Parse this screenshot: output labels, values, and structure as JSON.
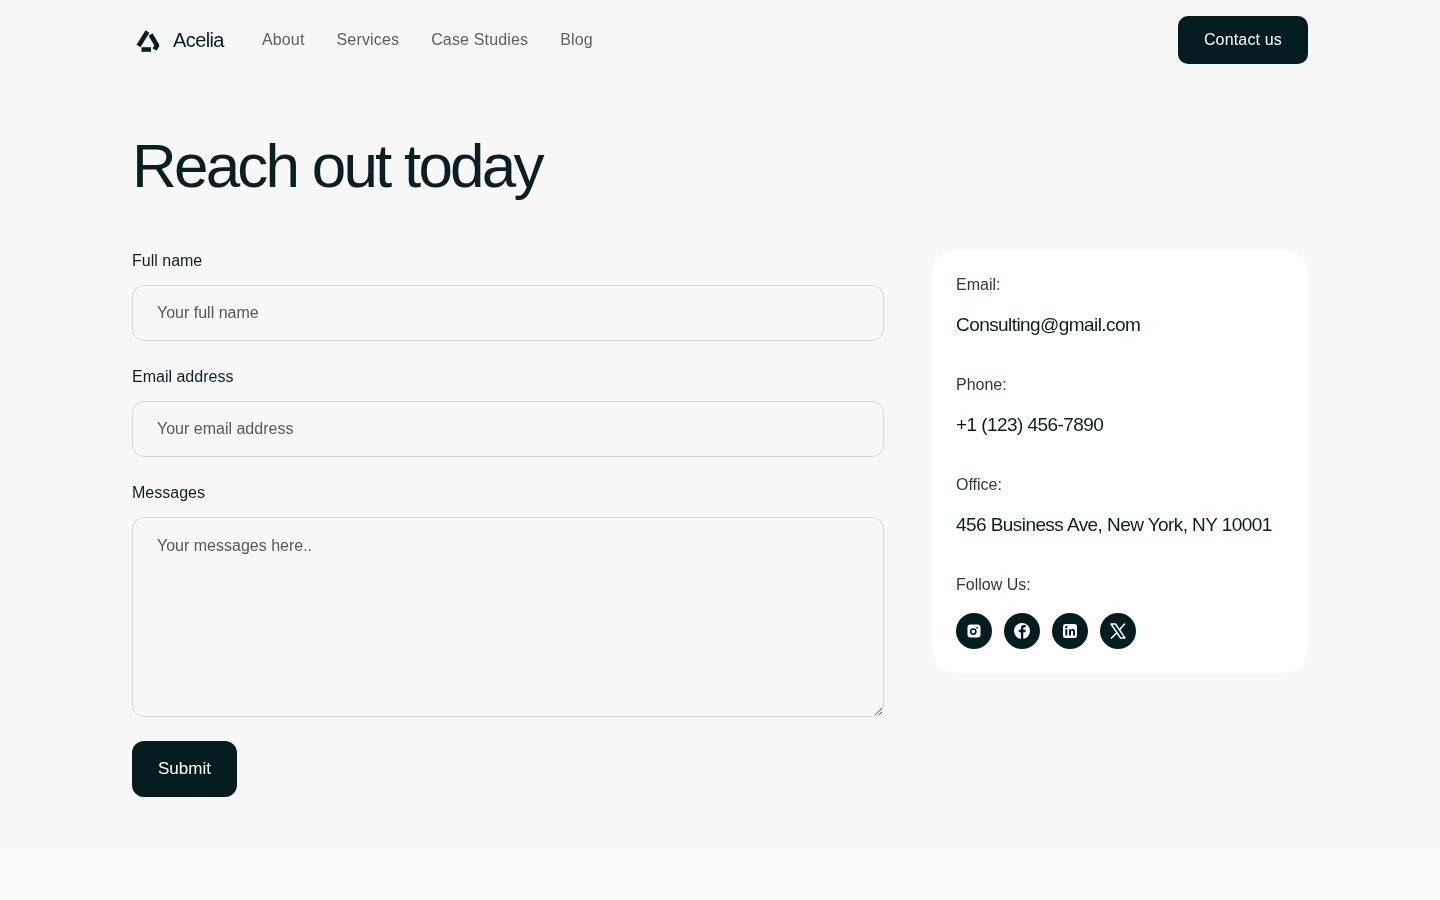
{
  "nav": {
    "brand": "Acelia",
    "links": [
      "About",
      "Services",
      "Case Studies",
      "Blog"
    ],
    "cta": "Contact us"
  },
  "heading": "Reach out today",
  "form": {
    "fields": [
      {
        "kind": "input",
        "label": "Full name",
        "placeholder": "Your full name"
      },
      {
        "kind": "input",
        "label": "Email address",
        "placeholder": "Your email address"
      },
      {
        "kind": "textarea",
        "label": "Messages",
        "placeholder": "Your messages here.."
      }
    ],
    "submit": "Submit"
  },
  "contact_card": {
    "items": [
      {
        "label": "Email:",
        "value": "Consulting@gmail.com"
      },
      {
        "label": "Phone:",
        "value": "+1 (123) 456-7890"
      },
      {
        "label": "Office:",
        "value": "456 Business Ave, New York, NY 10001"
      }
    ],
    "follow_label": "Follow Us:"
  }
}
